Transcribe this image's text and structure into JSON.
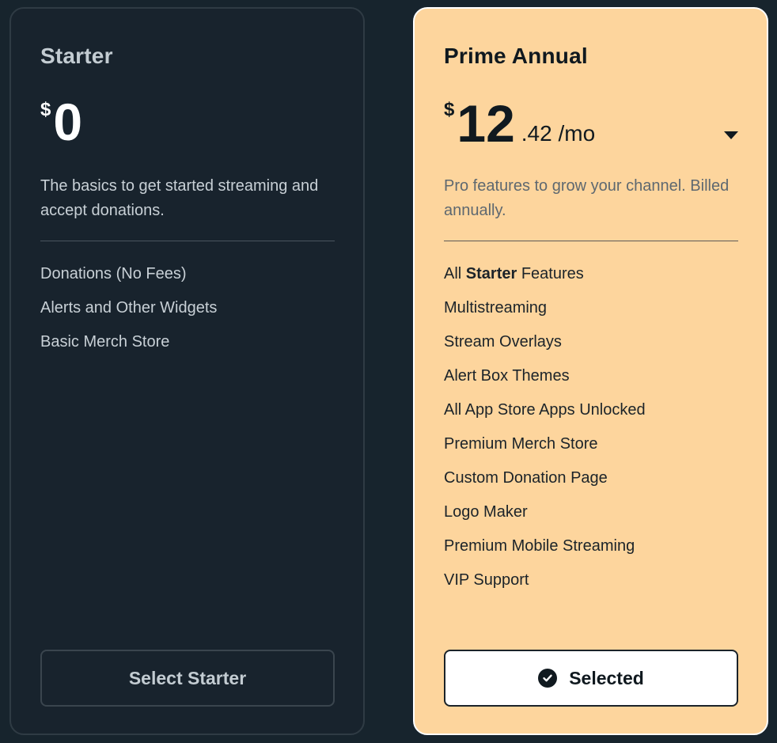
{
  "plans": {
    "starter": {
      "name": "Starter",
      "currency": "$",
      "amount": "0",
      "description": "The basics to get started streaming and accept donations.",
      "features": [
        "Donations (No Fees)",
        "Alerts and Other Widgets",
        "Basic Merch Store"
      ],
      "button_label": "Select Starter"
    },
    "prime": {
      "name": "Prime Annual",
      "currency": "$",
      "amount": "12",
      "cents_period": ".42 /mo",
      "description": "Pro features to grow your channel. Billed annually.",
      "features": [
        {
          "prefix": "All ",
          "bold": "Starter",
          "suffix": " Features"
        },
        "Multistreaming",
        "Stream Overlays",
        "Alert Box Themes",
        "All App Store Apps Unlocked",
        "Premium Merch Store",
        "Custom Donation Page",
        "Logo Maker",
        "Premium Mobile Streaming",
        "VIP Support"
      ],
      "button_label": "Selected",
      "button_icon": "check-circle-icon",
      "dropdown_icon": "caret-down-icon"
    }
  },
  "colors": {
    "background": "#17242d",
    "starter_card": "#18232d",
    "prime_card": "#fdd59d",
    "text_dark": "#10191f"
  }
}
